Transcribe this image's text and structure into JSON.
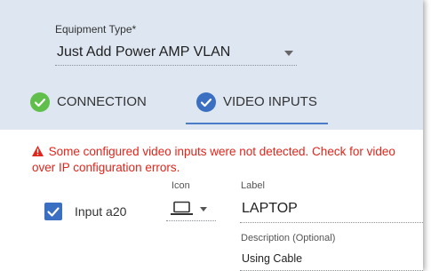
{
  "equipment": {
    "label": "Equipment Type*",
    "value": "Just Add Power AMP VLAN"
  },
  "tabs": [
    {
      "label": "CONNECTION",
      "icon": "check-circle-icon",
      "color": "#5fbf4a"
    },
    {
      "label": "VIDEO INPUTS",
      "icon": "check-circle-icon",
      "color": "#3a6fc1",
      "active": true
    }
  ],
  "warning": {
    "icon": "warning-triangle-icon",
    "text": "Some configured video inputs were not detected.  Check for video over IP configuration errors.",
    "color": "#e1251b"
  },
  "input_row": {
    "checked": true,
    "name": "Input a20",
    "icon_label": "Icon",
    "icon_value": "laptop-icon",
    "label_label": "Label",
    "label_value": "LAPTOP",
    "description_label": "Description (Optional)",
    "description_value": "Using Cable"
  },
  "colors": {
    "header_bg": "#dde6f1",
    "accent": "#3a6fc1"
  }
}
